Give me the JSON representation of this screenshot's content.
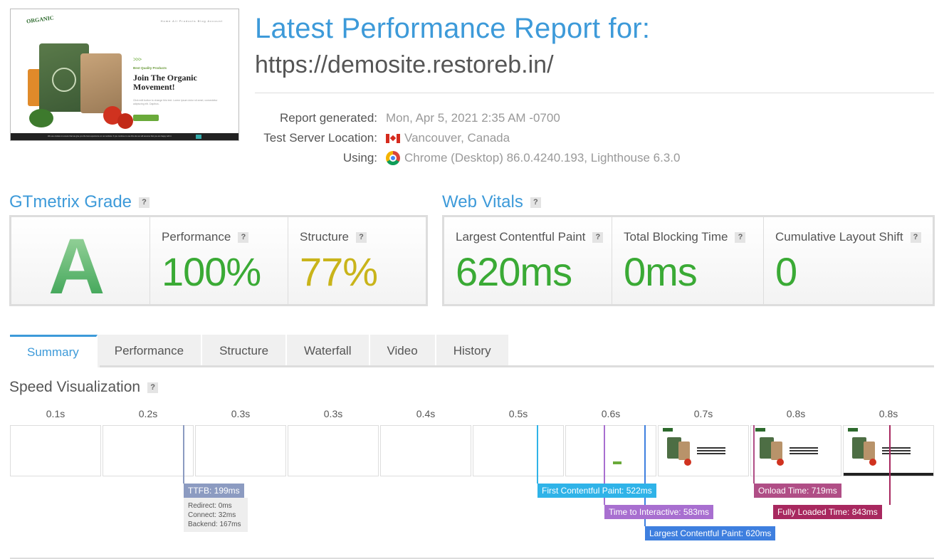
{
  "thumbnail": {
    "logo": "ORGANIC",
    "nav": "Home   All Products   Blog   Account",
    "tagline": "Best Quality Products",
    "headline": "Join The Organic Movement!",
    "body": "Click edit button to change this text. Lorem ipsum dolor sit amet, consectetur adipiscing elit. Dapibus.",
    "cookie": "We use cookies to ensure that we give you the best experience on our website. If you continue to use this site we will assume that you are happy with it."
  },
  "header": {
    "title": "Latest Performance Report for:",
    "url": "https://demosite.restoreb.in/"
  },
  "meta": [
    {
      "key": "Report generated:",
      "value": "Mon, Apr 5, 2021 2:35 AM -0700",
      "icon": null
    },
    {
      "key": "Test Server Location:",
      "value": "Vancouver, Canada",
      "icon": "canada-flag-icon"
    },
    {
      "key": "Using:",
      "value": "Chrome (Desktop) 86.0.4240.193, Lighthouse 6.3.0",
      "icon": "chrome-icon"
    }
  ],
  "grade": {
    "heading": "GTmetrix Grade",
    "help": "?",
    "letter": "A",
    "performance_label": "Performance",
    "performance_value": "100%",
    "structure_label": "Structure",
    "structure_value": "77%"
  },
  "vitals": {
    "heading": "Web Vitals",
    "help": "?",
    "lcp_label": "Largest Contentful Paint",
    "lcp_value": "620ms",
    "tbt_label": "Total Blocking Time",
    "tbt_value": "0ms",
    "cls_label": "Cumulative Layout Shift",
    "cls_value": "0"
  },
  "tabs": [
    "Summary",
    "Performance",
    "Structure",
    "Waterfall",
    "Video",
    "History"
  ],
  "active_tab": "Summary",
  "speed_viz": {
    "heading": "Speed Visualization",
    "help": "?",
    "ticks": [
      "0.1s",
      "0.2s",
      "0.3s",
      "0.3s",
      "0.4s",
      "0.5s",
      "0.6s",
      "0.7s",
      "0.8s",
      "0.8s"
    ],
    "markers": {
      "ttfb": "TTFB: 199ms",
      "ttfb_detail": [
        "Redirect: 0ms",
        "Connect: 32ms",
        "Backend: 167ms"
      ],
      "fcp": "First Contentful Paint: 522ms",
      "tti": "Time to Interactive: 583ms",
      "lcp": "Largest Contentful Paint: 620ms",
      "onload": "Onload Time: 719ms",
      "fully": "Fully Loaded Time: 843ms"
    }
  },
  "colors": {
    "accent": "#3d9ad9",
    "good": "#3aaa35",
    "warn": "#c9b41a",
    "ttfb": "#8c9bc1",
    "fcp": "#2fb3e8",
    "tti": "#a86fd0",
    "lcp": "#3e7fdf",
    "onload": "#b04e86",
    "fully": "#a8285f"
  }
}
